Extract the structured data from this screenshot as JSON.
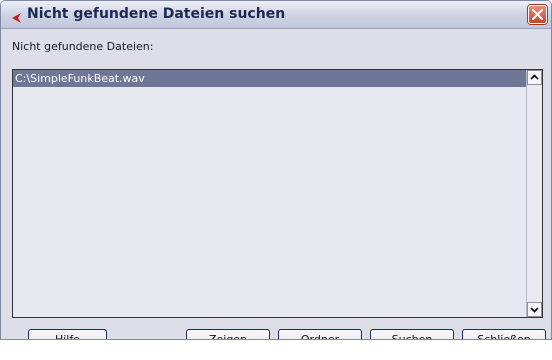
{
  "window": {
    "title": "Nicht gefundene Dateien suchen",
    "app_icon": "cubase-logo-icon",
    "close_icon": "close-icon"
  },
  "list": {
    "label": "Nicht gefundene Dateien:",
    "items": [
      {
        "label": "C:\\SimpleFunkBeat.wav",
        "selected": true
      }
    ]
  },
  "scrollbar": {
    "up_icon": "chevron-up-icon",
    "down_icon": "chevron-down-icon"
  },
  "buttons": {
    "help": "Hilfe",
    "show": "Zeigen",
    "folder": "Ordner",
    "search": "Suchen",
    "close": "Schließen"
  },
  "colors": {
    "selection": "#6e7798",
    "close_button": "#c8452a",
    "button_border": "#1b2b68"
  }
}
